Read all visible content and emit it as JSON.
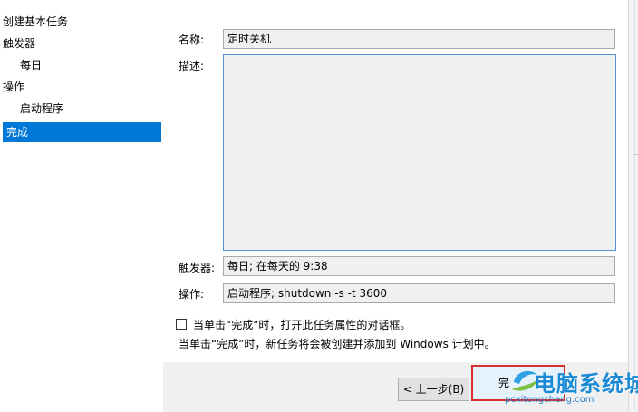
{
  "sidebar": {
    "items": [
      {
        "label": "创建基本任务"
      },
      {
        "label": "触发器"
      },
      {
        "label": "每日"
      },
      {
        "label": "操作"
      },
      {
        "label": "启动程序"
      },
      {
        "label": "完成"
      }
    ]
  },
  "form": {
    "name_label": "名称:",
    "name_value": "定时关机",
    "description_label": "描述:",
    "description_value": "",
    "trigger_label": "触发器:",
    "trigger_value": "每日; 在每天的 9:38",
    "action_label": "操作:",
    "action_value": "启动程序; shutdown -s -t 3600"
  },
  "checkbox": {
    "label": "当单击“完成”时，打开此任务属性的对话框。",
    "checked": false
  },
  "note": "当单击“完成”时，新任务将会被创建并添加到 Windows 计划中。",
  "buttons": {
    "back": "< 上一步(B)",
    "finish": "完"
  },
  "watermark": {
    "text": "电脑系统城",
    "url": "pcxitongcheng.com"
  },
  "colors": {
    "selection": "#0078d7",
    "highlight_box": "#d32f2f"
  }
}
